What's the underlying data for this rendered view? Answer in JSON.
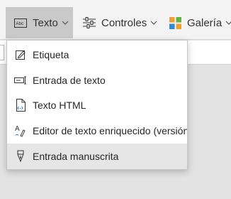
{
  "toolbar": {
    "texto_label": "Texto",
    "controles_label": "Controles",
    "galeria_label": "Galería"
  },
  "menu": {
    "items": [
      {
        "label": "Etiqueta",
        "icon": "label-edit-icon"
      },
      {
        "label": "Entrada de texto",
        "icon": "text-input-icon"
      },
      {
        "label": "Texto HTML",
        "icon": "html-document-icon"
      },
      {
        "label": "Editor de texto enriquecido (versión",
        "icon": "rich-text-icon"
      },
      {
        "label": "Entrada manuscrita",
        "icon": "pen-input-icon"
      }
    ],
    "highlighted_index": 4
  },
  "colors": {
    "toolbar_bg": "#f3f3f3",
    "active_tab_bg": "#c9c9c9",
    "canvas_bg": "#e3e3e3",
    "menu_highlight": "#e6e6e6",
    "galeria_icon_orange": "#f0a030",
    "galeria_icon_green": "#62b146",
    "galeria_icon_blue": "#2f8bd8"
  }
}
